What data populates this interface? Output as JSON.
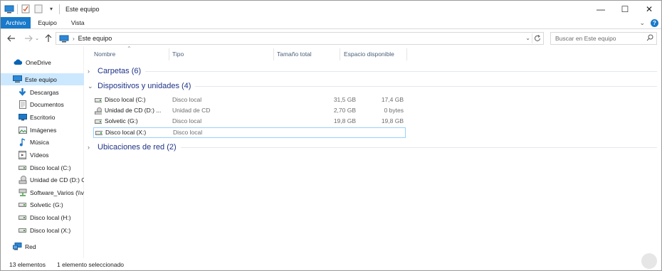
{
  "window": {
    "title": "Este equipo",
    "controls": {
      "minimize": "—",
      "maximize": "☐",
      "close": "✕"
    }
  },
  "ribbon": {
    "tabs": [
      {
        "label": "Archivo",
        "active": true
      },
      {
        "label": "Equipo"
      },
      {
        "label": "Vista"
      }
    ],
    "expand_icon": "chevron-down-icon",
    "help_icon": "help-icon",
    "help_label": "?"
  },
  "address": {
    "path_segment": "Este equipo",
    "search_placeholder": "Buscar en Este equipo"
  },
  "nav": {
    "items": [
      {
        "label": "OneDrive",
        "icon": "cloud-icon"
      },
      {
        "label": "Este equipo",
        "icon": "computer-icon",
        "selected": true
      },
      {
        "label": "Descargas",
        "icon": "download-icon"
      },
      {
        "label": "Documentos",
        "icon": "document-icon"
      },
      {
        "label": "Escritorio",
        "icon": "desktop-icon"
      },
      {
        "label": "Imágenes",
        "icon": "image-icon"
      },
      {
        "label": "Música",
        "icon": "music-icon"
      },
      {
        "label": "Vídeos",
        "icon": "video-icon"
      },
      {
        "label": "Disco local (C:)",
        "icon": "drive-icon"
      },
      {
        "label": "Unidad de CD (D:) C",
        "icon": "cd-drive-icon"
      },
      {
        "label": "Software_Varios (\\\\v",
        "icon": "network-drive-icon"
      },
      {
        "label": "Solvetic (G:)",
        "icon": "drive-icon"
      },
      {
        "label": "Disco local (H:)",
        "icon": "drive-icon"
      },
      {
        "label": "Disco local (X:)",
        "icon": "drive-icon"
      },
      {
        "label": "Red",
        "icon": "network-icon"
      }
    ]
  },
  "columns": {
    "name": "Nombre",
    "type": "Tipo",
    "total": "Tamaño total",
    "free": "Espacio disponible"
  },
  "groups": {
    "folders": {
      "label": "Carpetas (6)",
      "expanded": false
    },
    "devices": {
      "label": "Dispositivos y unidades (4)",
      "expanded": true
    },
    "network": {
      "label": "Ubicaciones de red (2)",
      "expanded": false
    }
  },
  "devices": [
    {
      "name": "Disco local (C:)",
      "type": "Disco local",
      "total": "31,5 GB",
      "free": "17,4 GB",
      "icon": "drive-icon"
    },
    {
      "name": "Unidad de CD (D:) ...",
      "type": "Unidad de CD",
      "total": "2,70 GB",
      "free": "0 bytes",
      "icon": "cd-drive-icon"
    },
    {
      "name": "Solvetic (G:)",
      "type": "Disco local",
      "total": "19,8 GB",
      "free": "19,8 GB",
      "icon": "drive-icon"
    },
    {
      "name": "Disco local (X:)",
      "type": "Disco local",
      "total": "",
      "free": "",
      "icon": "drive-icon",
      "selected": true
    }
  ],
  "status": {
    "count": "13 elementos",
    "selection": "1 elemento seleccionado"
  },
  "colors": {
    "accent": "#1979ca",
    "selection": "#cce8ff",
    "group_text": "#1e3287"
  }
}
